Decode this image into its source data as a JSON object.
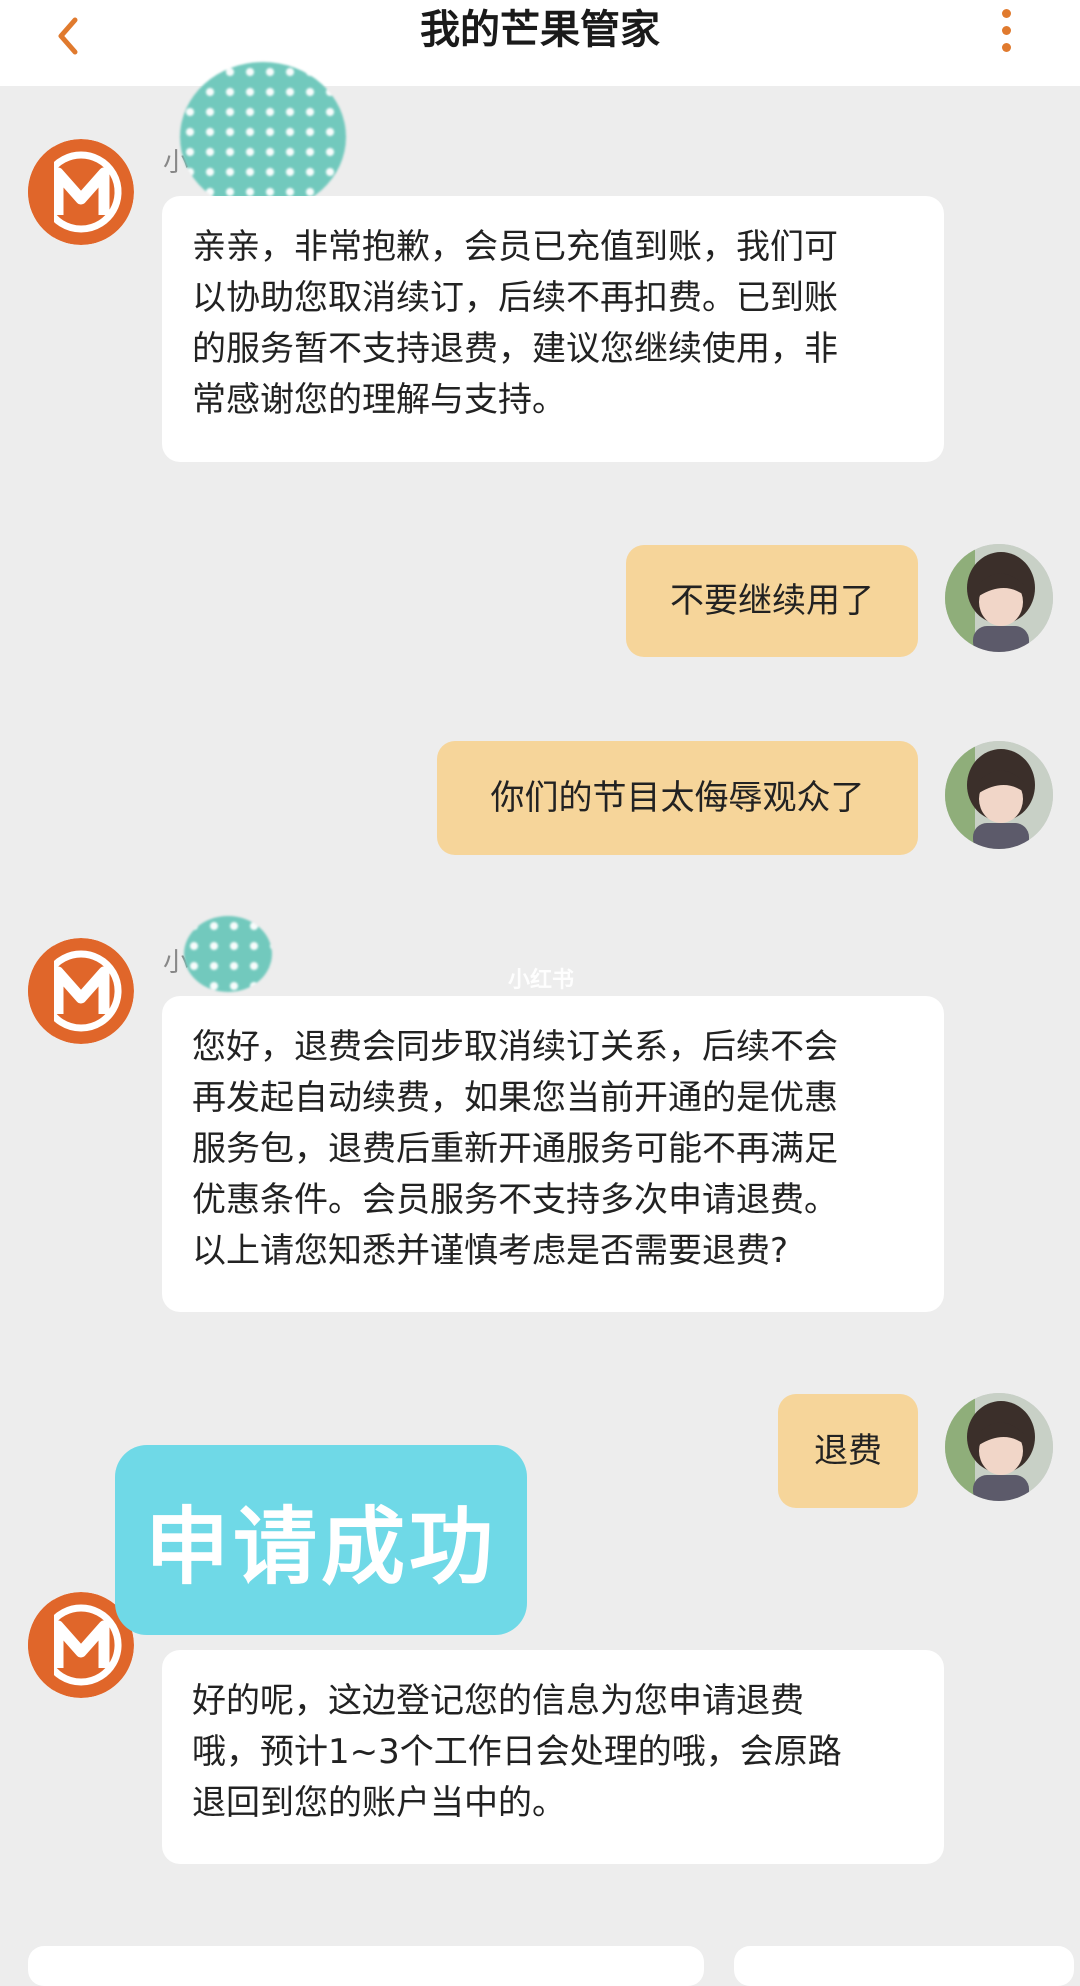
{
  "header": {
    "title": "我的芒果管家",
    "back_icon": "chevron-left-icon",
    "more_icon": "vertical-dots-icon",
    "accent_color": "#e07a2e"
  },
  "messages": [
    {
      "side": "left",
      "sender": "小",
      "lines": [
        "亲亲，非常抱歉，会员已充值到账，我们可",
        "以协助您取消续订，后续不再扣费。已到账",
        "的服务暂不支持退费，建议您继续使用，非",
        "常感谢您的理解与支持。"
      ]
    },
    {
      "side": "right",
      "text": "不要继续用了"
    },
    {
      "side": "right",
      "text": "你们的节目太侮辱观众了"
    },
    {
      "side": "left",
      "sender": "小",
      "lines": [
        "您好，退费会同步取消续订关系，后续不会",
        "再发起自动续费，如果您当前开通的是优惠",
        "服务包，退费后重新开通服务可能不再满足",
        "优惠条件。会员服务不支持多次申请退费。",
        "以上请您知悉并谨慎考虑是否需要退费?"
      ]
    },
    {
      "side": "right",
      "text": "退费"
    },
    {
      "side": "left",
      "lines": [
        "好的呢，这边登记您的信息为您申请退费",
        "哦，预计1~3个工作日会处理的哦，会原路",
        "退回到您的账户当中的。"
      ]
    }
  ],
  "sticker_text": "申请成功",
  "watermark": "小红书",
  "colors": {
    "background": "#ededed",
    "bot_bubble": "#ffffff",
    "user_bubble": "#f6d59a",
    "brand_orange": "#e0662a",
    "sticker": "#6fd9e7"
  }
}
